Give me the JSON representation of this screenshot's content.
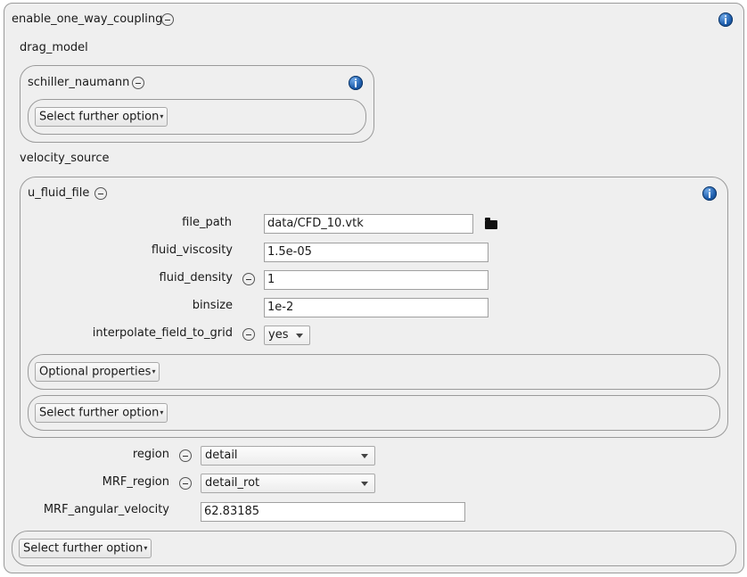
{
  "root": {
    "title": "enable_one_way_coupling",
    "further_option_label": "Select further option"
  },
  "drag_model": {
    "heading": "drag_model",
    "child_title": "schiller_naumann",
    "further_option_label": "Select further option"
  },
  "velocity_source": {
    "heading": "velocity_source",
    "child_title": "u_fluid_file",
    "fields": {
      "file_path": {
        "label": "file_path",
        "value": "data/CFD_10.vtk"
      },
      "fluid_viscosity": {
        "label": "fluid_viscosity",
        "value": "1.5e-05"
      },
      "fluid_density": {
        "label": "fluid_density",
        "value": "1"
      },
      "binsize": {
        "label": "binsize",
        "value": "1e-2"
      },
      "interpolate_field_to_grid": {
        "label": "interpolate_field_to_grid",
        "value": "yes"
      }
    },
    "optional_properties_label": "Optional properties",
    "further_option_label": "Select further option"
  },
  "region": {
    "label": "region",
    "value": "detail"
  },
  "mrf_region": {
    "label": "MRF_region",
    "value": "detail_rot"
  },
  "mrf_angular_velocity": {
    "label": "MRF_angular_velocity",
    "value": "62.83185"
  },
  "icons": {
    "remove": "minus-circle-icon",
    "info": "info-icon",
    "browse": "folder-icon",
    "dropdown": "chevron-down-icon"
  }
}
